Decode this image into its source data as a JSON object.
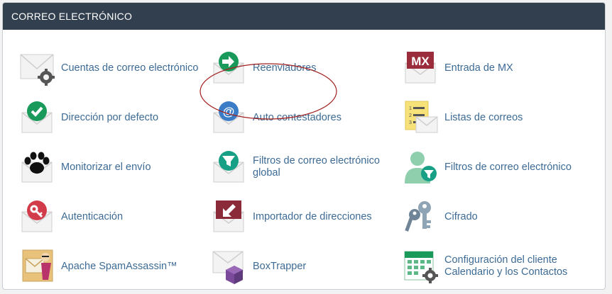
{
  "panel": {
    "title": "CORREO ELECTRÓNICO"
  },
  "items": [
    {
      "label": "Cuentas de correo electrónico",
      "icon": "email-accounts-icon"
    },
    {
      "label": "Reenviadores",
      "icon": "forwarders-icon"
    },
    {
      "label": "Entrada de MX",
      "icon": "mx-entry-icon"
    },
    {
      "label": "Dirección por defecto",
      "icon": "default-address-icon"
    },
    {
      "label": "Auto contestadores",
      "icon": "autoresponders-icon"
    },
    {
      "label": "Listas de correos",
      "icon": "mailing-lists-icon"
    },
    {
      "label": "Monitorizar el envío",
      "icon": "track-delivery-icon"
    },
    {
      "label": "Filtros de correo electrónico global",
      "icon": "global-email-filters-icon"
    },
    {
      "label": "Filtros de correo electrónico",
      "icon": "email-filters-icon"
    },
    {
      "label": "Autenticación",
      "icon": "authentication-icon"
    },
    {
      "label": "Importador de direcciones",
      "icon": "address-importer-icon"
    },
    {
      "label": "Cifrado",
      "icon": "encryption-icon"
    },
    {
      "label": "Apache SpamAssassin™",
      "icon": "spamassassin-icon"
    },
    {
      "label": "BoxTrapper",
      "icon": "boxtrapper-icon"
    },
    {
      "label": "Configuración del cliente Calendario y los Contactos",
      "icon": "calendar-contacts-icon"
    }
  ],
  "colors": {
    "header_bg": "#323f4f",
    "link": "#3d6b95",
    "green": "#1a9a5a",
    "blue": "#3a7cc6",
    "red": "#c0392b",
    "maroon": "#8b2b3a"
  }
}
